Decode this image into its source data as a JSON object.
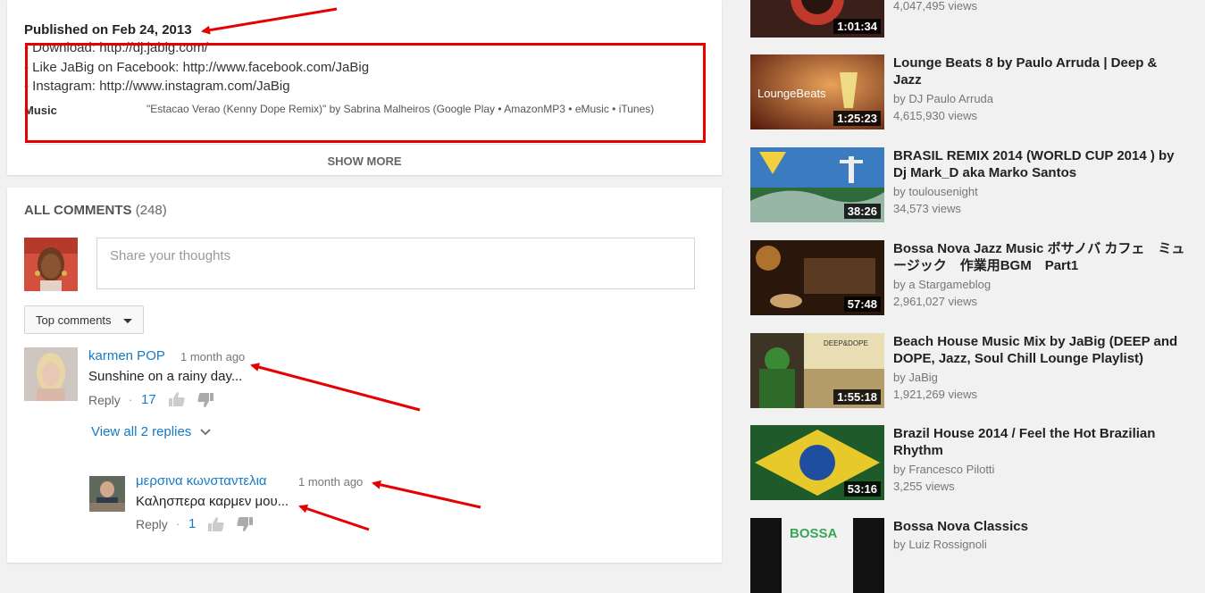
{
  "description": {
    "published": "Published on Feb 24, 2013",
    "lines": [
      "- Download: http://dj.jabig.com/",
      "- Like JaBig on Facebook: http://www.facebook.com/JaBig",
      "- Instagram: http://www.instagram.com/JaBig"
    ],
    "music_label": "Music",
    "music_text": "\"Estacao Verao (Kenny Dope Remix)\" by Sabrina Malheiros (Google Play • AmazonMP3 • eMusic • iTunes)",
    "show_more": "SHOW MORE"
  },
  "comments": {
    "header": "ALL COMMENTS",
    "count": "(248)",
    "share_placeholder": "Share your thoughts",
    "sort_label": "Top comments",
    "items": [
      {
        "author": "karmen POP",
        "time": "1 month ago",
        "text": "Sunshine on a rainy day...",
        "reply_label": "Reply",
        "separator": "·",
        "likes": "17",
        "view_replies": "View all 2 replies"
      },
      {
        "author": "μερσινα κωνσταντελια",
        "time": "1 month ago",
        "text": "Καλησπερα καρμεν μου...",
        "reply_label": "Reply",
        "separator": "·",
        "likes": "1"
      }
    ]
  },
  "sidebar": {
    "videos": [
      {
        "title": "",
        "by": "",
        "views": "4,047,495 views",
        "duration": "1:01:34"
      },
      {
        "title": "Lounge Beats 8 by Paulo Arruda | Deep & Jazz",
        "by": "by DJ Paulo Arruda",
        "views": "4,615,930 views",
        "duration": "1:25:23",
        "thumb_text": "LoungeBeats"
      },
      {
        "title": "BRASIL REMIX 2014 (WORLD CUP 2014 ) by Dj Mark_D aka Marko Santos",
        "by": "by toulousenight",
        "views": "34,573 views",
        "duration": "38:26"
      },
      {
        "title": "Bossa Nova Jazz Music ボサノバ カフェ　ミュージック　作業用BGM　Part1",
        "by": "by a Stargameblog",
        "views": "2,961,027 views",
        "duration": "57:48"
      },
      {
        "title": "Beach House Music Mix by JaBig (DEEP and DOPE, Jazz, Soul Chill Lounge Playlist)",
        "by": "by JaBig",
        "views": "1,921,269 views",
        "duration": "1:55:18",
        "thumb_text": "DEEP&DOPE"
      },
      {
        "title": "Brazil House 2014 / Feel the Hot Brazilian Rhythm",
        "by": "by Francesco Pilotti",
        "views": "3,255 views",
        "duration": "53:16"
      },
      {
        "title": "Bossa Nova Classics",
        "by": "by Luiz Rossignoli",
        "views": "",
        "duration": "",
        "thumb_text": "BOSSA"
      }
    ]
  },
  "colors": {
    "link_blue": "#167ac6",
    "annotation_red": "#e60000",
    "background": "#f1f1f1"
  }
}
